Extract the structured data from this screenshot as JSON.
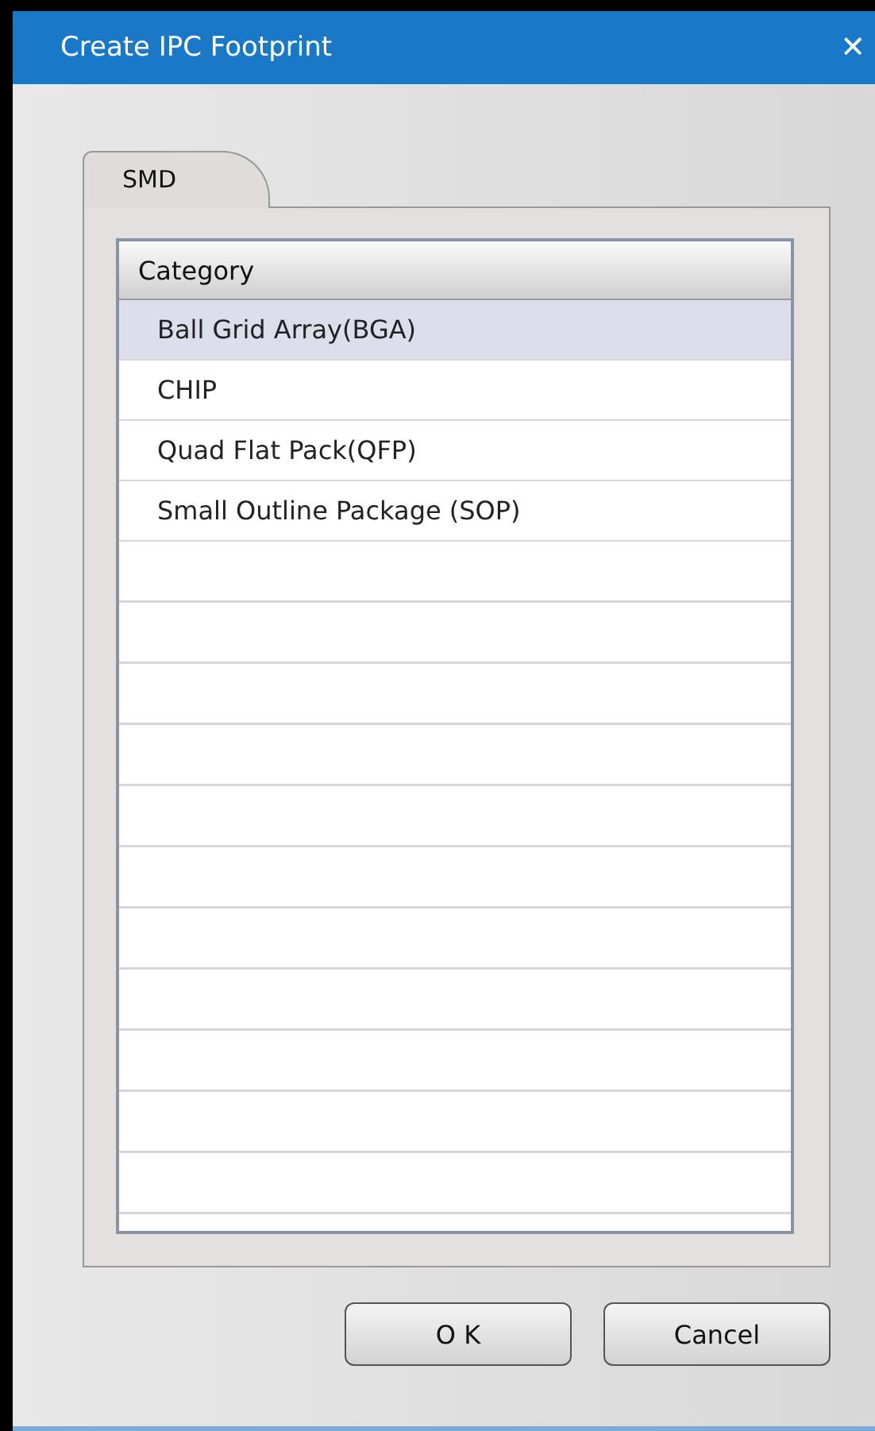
{
  "window": {
    "title": "Create IPC Footprint",
    "close": "✕"
  },
  "tabs": [
    {
      "label": "SMD",
      "selected": true
    }
  ],
  "list": {
    "header": "Category",
    "rows": [
      {
        "label": "Ball Grid Array(BGA)",
        "selected": true
      },
      {
        "label": "CHIP",
        "selected": false
      },
      {
        "label": "Quad Flat Pack(QFP)",
        "selected": false
      },
      {
        "label": "Small Outline Package (SOP)",
        "selected": false
      }
    ]
  },
  "buttons": [
    "O K",
    "Cancel"
  ]
}
